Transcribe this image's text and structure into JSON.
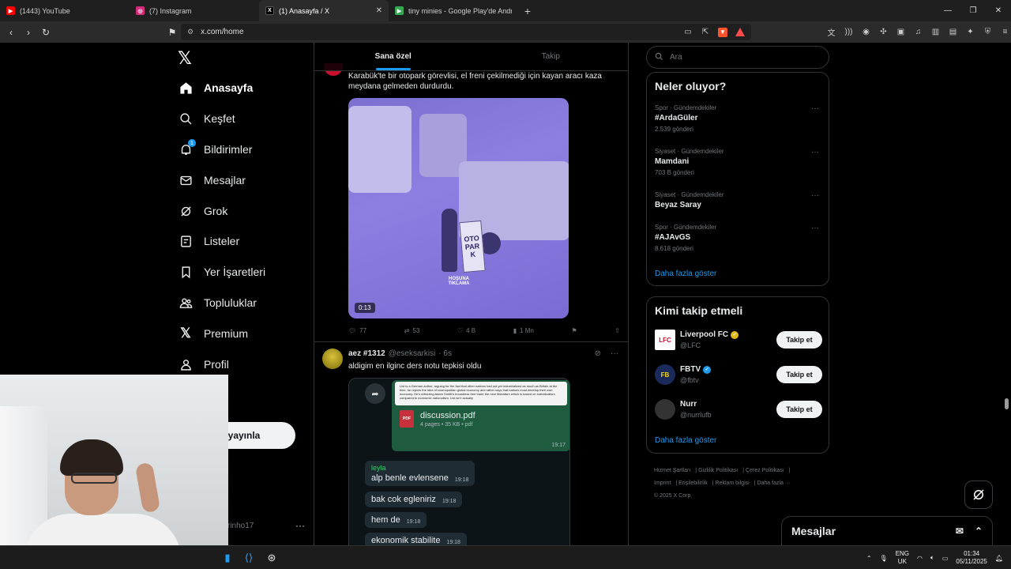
{
  "browser": {
    "tabs": [
      {
        "title": "(1443) YouTube",
        "icon": "youtube-icon",
        "color": "#ff0000",
        "active": false
      },
      {
        "title": "(7) Instagram",
        "icon": "instagram-icon",
        "color": "#d62976",
        "active": false
      },
      {
        "title": "(1) Anasayfa / X",
        "icon": "x-icon",
        "color": "#000000",
        "active": true
      },
      {
        "title": "tiny minies - Google Play'de Android",
        "icon": "google-play-icon",
        "color": "#34a853",
        "active": false
      }
    ],
    "url": "x.com/home"
  },
  "nav": {
    "items": [
      {
        "label": "Anasayfa",
        "icon": "home-icon"
      },
      {
        "label": "Keşfet",
        "icon": "search-icon"
      },
      {
        "label": "Bildirimler",
        "icon": "bell-icon",
        "badge": "1"
      },
      {
        "label": "Mesajlar",
        "icon": "mail-icon"
      },
      {
        "label": "Grok",
        "icon": "grok-icon"
      },
      {
        "label": "Listeler",
        "icon": "list-icon"
      },
      {
        "label": "Yer İşaretleri",
        "icon": "bookmark-icon"
      },
      {
        "label": "Topluluklar",
        "icon": "communities-icon"
      },
      {
        "label": "Premium",
        "icon": "x-premium-icon"
      },
      {
        "label": "Profil",
        "icon": "profile-icon"
      },
      {
        "label": "fazla",
        "icon": "more-icon"
      }
    ],
    "post_button": "eri yayınla",
    "user_handle": "rinho17",
    "user_more": "···"
  },
  "feed": {
    "tabs": [
      "Sana özel",
      "Takip"
    ],
    "post1": {
      "text_line1": "Karabük'te bir otopark görevlisi, el freni çekilmediği için kayan aracı kaza",
      "text_line2": "meydana gelmeden durdurdu.",
      "video_duration": "0:13",
      "sign_text": "OTO PARK",
      "overlay_hint": "HOŞUNA TIKLAMA",
      "replies": "77",
      "reposts": "53",
      "likes": "4 B",
      "views": "1 Mn"
    },
    "post2": {
      "name": "aez #1312",
      "handle": "@eseksarkisi",
      "time": "· 6s",
      "text": "aldigim en ilginc ders notu tepkisi oldu",
      "pdf_preview": "List is a German author, arguing for the fact that other nations had not yet industrialized as much as Britain at the time, he rejects the idea of cosmopolitan global economy and rather says that nations must develop their own economy. He's criticizing Adam Smith's boundless free trade the new liberalism which is based on individualism compared to economic nationalism. List isn't actually",
      "pdf_name": "discussion.pdf",
      "pdf_meta": "4 pages • 35 KB • pdf",
      "pdf_label": "PDF",
      "pdf_time": "19:17",
      "sender": "leyla",
      "messages": [
        {
          "text": "alp benle evlensene",
          "time": "19:18"
        },
        {
          "text": "bak cok egleniriz",
          "time": "19:18"
        },
        {
          "text": "hem de",
          "time": "19:18"
        },
        {
          "text": "ekonomik stabilite",
          "time": "19:18"
        }
      ]
    }
  },
  "right": {
    "search_placeholder": "Ara",
    "trends_title": "Neler oluyor?",
    "trends": [
      {
        "category": "Spor · Gündemdekiler",
        "name": "#ArdaGüler",
        "count": "2.539 gönderi"
      },
      {
        "category": "Siyaset · Gündemdekiler",
        "name": "Mamdani",
        "count": "703 B gönderi"
      },
      {
        "category": "Siyaset · Gündemdekiler",
        "name": "Beyaz Saray",
        "count": ""
      },
      {
        "category": "Spor · Gündemdekiler",
        "name": "#AJAvGS",
        "count": "8.618 gönderi"
      }
    ],
    "show_more": "Daha fazla göster",
    "who_title": "Kimi takip etmeli",
    "who": [
      {
        "name": "Liverpool FC",
        "handle": "@LFC",
        "badge_color": "#e2b719",
        "button": "Takip et"
      },
      {
        "name": "FBTV",
        "handle": "@fbtv",
        "badge_color": "#1d9bf0",
        "button": "Takip et"
      },
      {
        "name": "Nurr",
        "handle": "@nurrlufb",
        "badge_color": "",
        "button": "Takip et"
      }
    ],
    "who_show_more": "Daha fazla göster",
    "footer": [
      "Hizmet Şartları",
      "Gizlilik Politikası",
      "Çerez Politikası",
      "Imprint",
      "Erişilebilirlik",
      "Reklam bilgisi",
      "Daha fazla ···",
      "© 2025 X Corp."
    ],
    "messages_drawer": "Mesajlar"
  },
  "taskbar": {
    "lang": "ENG",
    "region": "UK",
    "time": "01:34",
    "date": "05/11/2025"
  }
}
